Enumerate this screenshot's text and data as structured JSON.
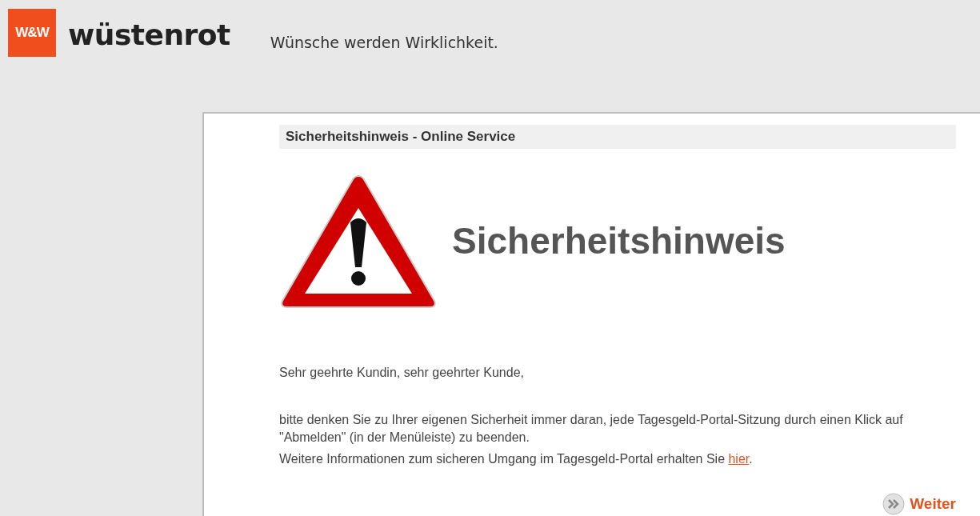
{
  "header": {
    "logo_mark": "W&W",
    "brand": "wüstenrot",
    "slogan": "Wünsche werden Wirklichkeit."
  },
  "panel": {
    "heading": "Sicherheitshinweis - Online Service",
    "title": "Sicherheitshinweis",
    "greeting": "Sehr geehrte Kundin, sehr geehrter Kunde,",
    "message": "bitte denken Sie zu Ihrer eigenen Sicherheit immer daran, jede Tagesgeld-Portal-Sitzung durch einen Klick auf  \"Abmelden\" (in der Menüleiste) zu beenden.",
    "info": {
      "before": "Weitere Informationen zum sicheren Umgang im Tagesgeld-Portal erhalten Sie ",
      "link": "hier",
      "after": "."
    },
    "next_button": "Weiter"
  }
}
